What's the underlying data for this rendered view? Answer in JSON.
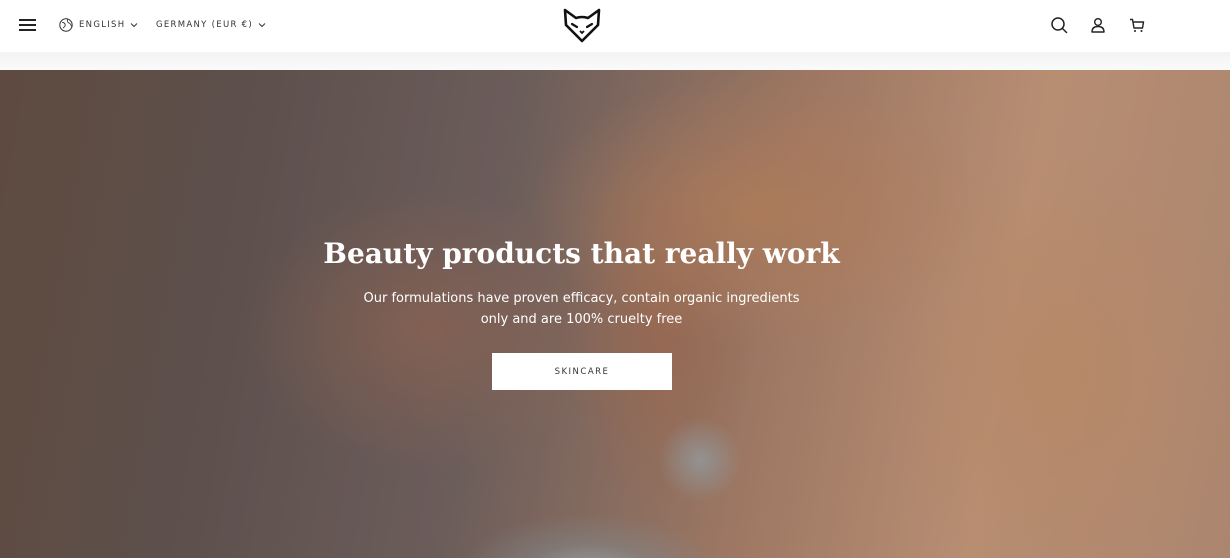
{
  "header": {
    "language": "ENGLISH",
    "country": "GERMANY (EUR €)",
    "icons": {
      "menu": "menu-icon",
      "globe": "globe-icon",
      "logo": "fox-logo",
      "search": "search-icon",
      "account": "account-icon",
      "cart": "cart-icon"
    }
  },
  "hero": {
    "title": "Beauty products that really work",
    "subtitle": "Our formulations have proven efficacy, contain organic ingredients only and are 100% cruelty free",
    "cta_label": "SKINCARE"
  },
  "colors": {
    "text_dark": "#222222",
    "hero_text": "#ffffff",
    "button_bg": "#ffffff"
  }
}
